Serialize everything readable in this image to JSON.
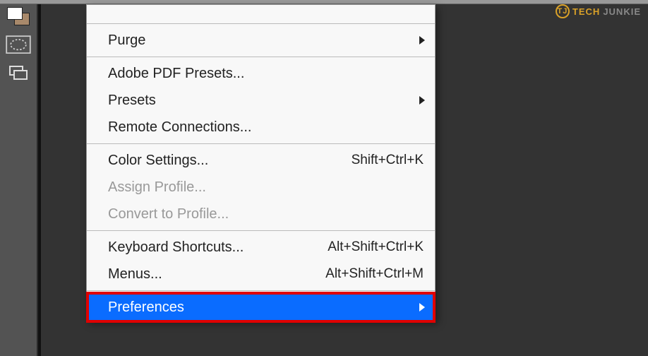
{
  "watermark": {
    "badge": "TJ",
    "part1": "TECH",
    "part2": "JUNKIE"
  },
  "menu": {
    "top_spacer": "",
    "purge": "Purge",
    "adobe_pdf": "Adobe PDF Presets...",
    "presets": "Presets",
    "remote": "Remote Connections...",
    "color_settings_label": "Color Settings...",
    "color_settings_shortcut": "Shift+Ctrl+K",
    "assign_profile": "Assign Profile...",
    "convert_profile": "Convert to Profile...",
    "keyboard_shortcuts_label": "Keyboard Shortcuts...",
    "keyboard_shortcuts_shortcut": "Alt+Shift+Ctrl+K",
    "menus_label": "Menus...",
    "menus_shortcut": "Alt+Shift+Ctrl+M",
    "preferences": "Preferences"
  }
}
